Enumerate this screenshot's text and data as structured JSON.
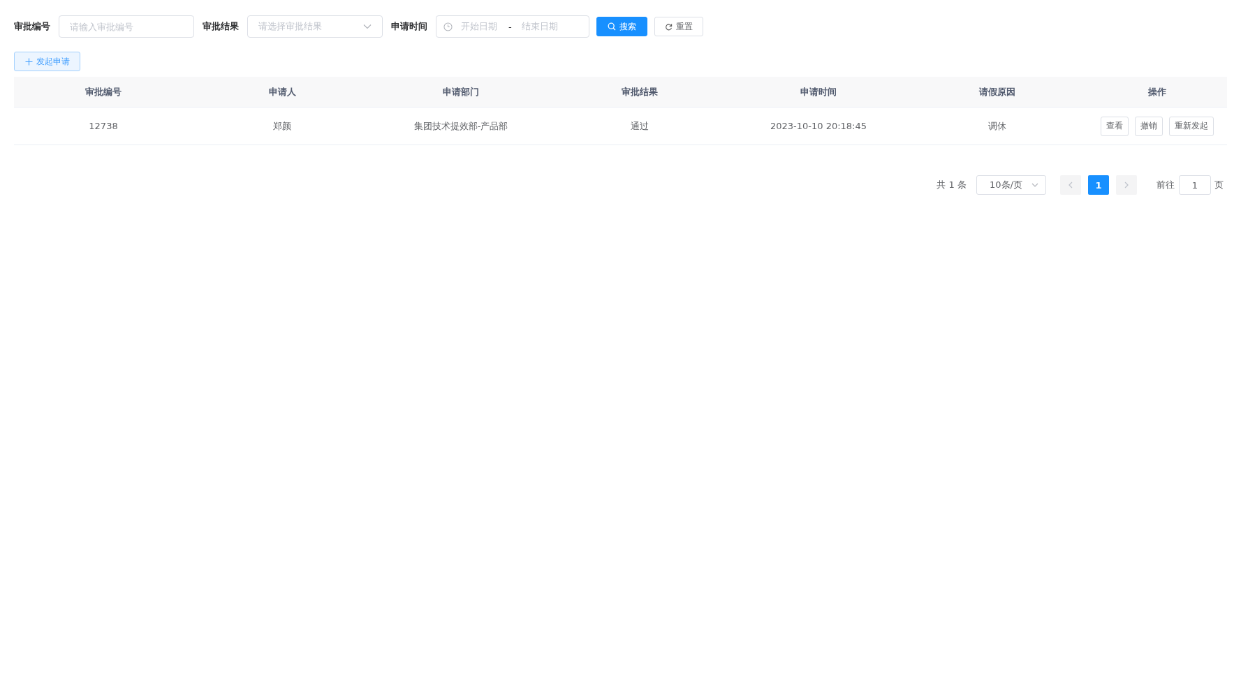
{
  "filters": [
    {
      "kind": "input",
      "label": "审批编号",
      "placeholder": "请输入审批编号"
    },
    {
      "kind": "select",
      "label": "审批结果",
      "placeholder": "请选择审批结果"
    },
    {
      "kind": "daterange",
      "label": "申请时间",
      "start_placeholder": "开始日期",
      "separator": "-",
      "end_placeholder": "结束日期"
    }
  ],
  "search_button": "搜索",
  "reset_button": "重置",
  "create_button": "发起申请",
  "table": {
    "columns": [
      "审批编号",
      "申请人",
      "申请部门",
      "审批结果",
      "申请时间",
      "请假原因",
      "操作"
    ],
    "rows": [
      {
        "cells": [
          "12738",
          "郑颜",
          "集团技术提效部-产品部",
          "通过",
          "2023-10-10 20:18:45",
          "调休"
        ],
        "actions": [
          "查看",
          "撤销",
          "重新发起"
        ]
      }
    ]
  },
  "pagination": {
    "total": "共 1 条",
    "page_size": "10条/页",
    "pages": [
      {
        "label": "1",
        "selected": true
      }
    ],
    "goto_label": "前往",
    "goto_value": "1",
    "goto_suffix": "页"
  }
}
